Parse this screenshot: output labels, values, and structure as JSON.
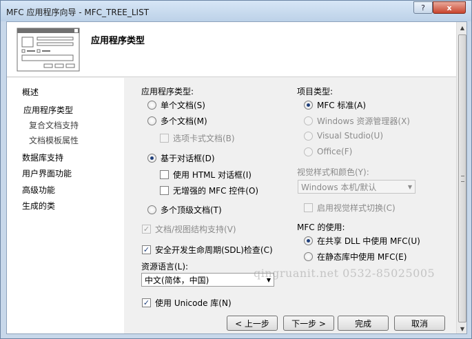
{
  "window": {
    "title": "MFC 应用程序向导 - MFC_TREE_LIST",
    "help_glyph": "?",
    "close_glyph": "x"
  },
  "header": {
    "title": "应用程序类型"
  },
  "sidebar": {
    "items": [
      {
        "label": "概述"
      },
      {
        "label": "应用程序类型"
      },
      {
        "label": "复合文档支持"
      },
      {
        "label": "文档模板属性"
      },
      {
        "label": "数据库支持"
      },
      {
        "label": "用户界面功能"
      },
      {
        "label": "高级功能"
      },
      {
        "label": "生成的类"
      }
    ]
  },
  "app_type": {
    "label": "应用程序类型:",
    "single_doc": "单个文档(S)",
    "multi_doc": "多个文档(M)",
    "tabbed_docs": "选项卡式文档(B)",
    "dialog_based": "基于对话框(D)",
    "use_html_dialog": "使用 HTML 对话框(I)",
    "no_enhanced_mfc": "无增强的 MFC 控件(O)",
    "multi_top_level": "多个顶级文档(T)",
    "doc_view": "文档/视图结构支持(V)",
    "sdl_check": "安全开发生命周期(SDL)检查(C)",
    "resource_lang_label": "资源语言(L):",
    "resource_lang_value": "中文(简体，中国)",
    "use_unicode": "使用 Unicode 库(N)"
  },
  "project_type": {
    "label": "项目类型:",
    "mfc_standard": "MFC 标准(A)",
    "windows_explorer": "Windows 资源管理器(X)",
    "visual_studio": "Visual Studio(U)",
    "office": "Office(F)",
    "visual_style_label": "视觉样式和颜色(Y):",
    "visual_style_value": "Windows 本机/默认",
    "enable_style_switch": "启用视觉样式切换(C)",
    "mfc_use_label": "MFC 的使用:",
    "shared_dll": "在共享 DLL 中使用 MFC(U)",
    "static_lib": "在静态库中使用 MFC(E)"
  },
  "buttons": {
    "prev": "< 上一步",
    "next": "下一步 >",
    "finish": "完成",
    "cancel": "取消"
  },
  "watermark": "qingruanit.net 0532-85025005"
}
